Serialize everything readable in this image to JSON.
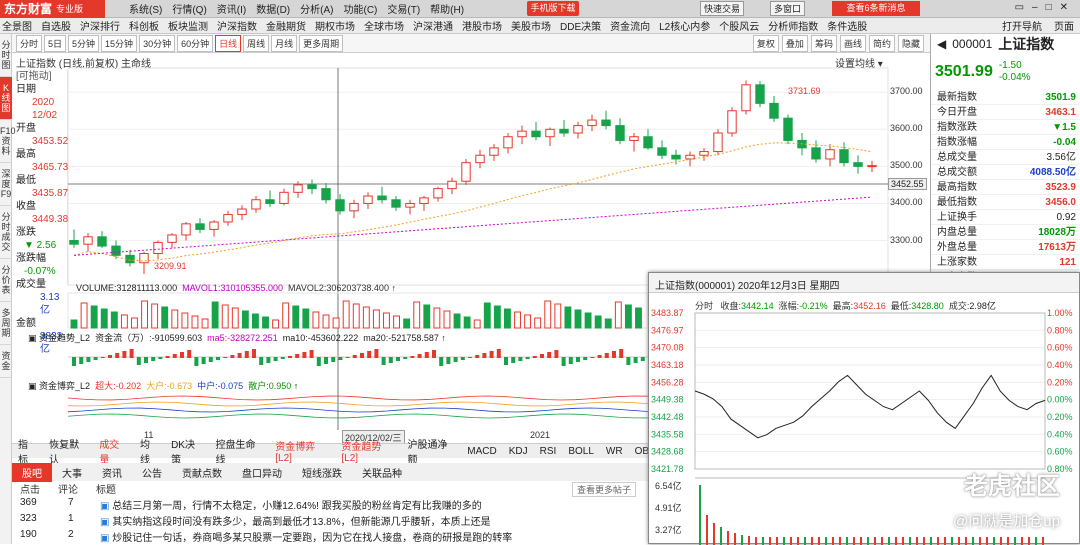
{
  "app": {
    "logo": "东方财富",
    "edition": "专业版"
  },
  "menu": [
    "系统(S)",
    "行情(Q)",
    "资讯(I)",
    "数据(D)",
    "分析(A)",
    "功能(C)",
    "交易(T)",
    "帮助(H)"
  ],
  "top_buttons": {
    "download": "手机版下载",
    "trade": "快速交易",
    "multi": "多窗口",
    "notice": "查看6条新消息"
  },
  "nav": {
    "items": [
      "全景图",
      "自选股",
      "沪深排行",
      "科创板",
      "板块监测",
      "沪深指数",
      "金融期货",
      "期权市场",
      "全球市场",
      "沪深港通",
      "港股市场",
      "美股市场",
      "DDE决策",
      "资金流向",
      "L2核心内参",
      "个股风云",
      "分析师指数",
      "条件选股"
    ],
    "right": [
      "打开导航",
      "页面"
    ]
  },
  "left_nav": [
    "分时图",
    "K线图",
    "F10资料",
    "深度F9",
    "分时成交",
    "分价表",
    "多周期",
    "资金"
  ],
  "period": {
    "items": [
      "分时",
      "5日",
      "5分钟",
      "15分钟",
      "30分钟",
      "60分钟",
      "日线",
      "周线",
      "月线",
      "更多周期"
    ],
    "active": "日线",
    "right": [
      "复权",
      "叠加",
      "筹码",
      "画线",
      "简约",
      "隐藏"
    ]
  },
  "chart": {
    "title": "上证指数 (日线,前复权) 主命线",
    "settings": "设置均线",
    "info": [
      {
        "k": "日期",
        "v": "2020"
      },
      {
        "k": "",
        "v": "12/02"
      },
      {
        "k": "开盘",
        "v": "3453.52"
      },
      {
        "k": "最高",
        "v": "3465.73"
      },
      {
        "k": "最低",
        "v": "3435.87"
      },
      {
        "k": "收盘",
        "v": "3449.38"
      },
      {
        "k": "涨跌",
        "v": "▼ 2.56"
      },
      {
        "k": "涨跌幅",
        "v": "-0.07%"
      },
      {
        "k": "成交量",
        "v": "3.13亿"
      },
      {
        "k": "金额",
        "v": "3833亿"
      }
    ],
    "info_tag": "[可拖动]",
    "price_ticks": [
      "3700.00",
      "3600.00",
      "3500.00",
      "3400.00",
      "3300.00"
    ],
    "current_price": "3452.55",
    "high_label": "3731.69",
    "low_label": "3209.91",
    "dates": [
      "11",
      "2020/12/02/三",
      "2021"
    ],
    "chart_data": {
      "type": "candlestick",
      "ylim": [
        3180,
        3760
      ],
      "ohlc": [
        [
          3300,
          3330,
          3280,
          3290
        ],
        [
          3290,
          3320,
          3270,
          3310
        ],
        [
          3310,
          3325,
          3280,
          3285
        ],
        [
          3285,
          3300,
          3250,
          3260
        ],
        [
          3260,
          3275,
          3230,
          3240
        ],
        [
          3240,
          3270,
          3210,
          3265
        ],
        [
          3265,
          3300,
          3250,
          3295
        ],
        [
          3295,
          3320,
          3280,
          3315
        ],
        [
          3315,
          3350,
          3300,
          3345
        ],
        [
          3345,
          3360,
          3320,
          3330
        ],
        [
          3330,
          3355,
          3310,
          3350
        ],
        [
          3350,
          3380,
          3340,
          3370
        ],
        [
          3370,
          3395,
          3355,
          3385
        ],
        [
          3385,
          3420,
          3375,
          3410
        ],
        [
          3410,
          3435,
          3390,
          3400
        ],
        [
          3400,
          3440,
          3395,
          3430
        ],
        [
          3430,
          3460,
          3415,
          3450
        ],
        [
          3450,
          3465,
          3425,
          3440
        ],
        [
          3440,
          3455,
          3400,
          3410
        ],
        [
          3410,
          3425,
          3370,
          3380
        ],
        [
          3380,
          3410,
          3360,
          3400
        ],
        [
          3400,
          3430,
          3385,
          3420
        ],
        [
          3420,
          3445,
          3400,
          3410
        ],
        [
          3410,
          3420,
          3380,
          3390
        ],
        [
          3390,
          3410,
          3370,
          3400
        ],
        [
          3400,
          3420,
          3380,
          3415
        ],
        [
          3415,
          3445,
          3405,
          3440
        ],
        [
          3440,
          3470,
          3425,
          3460
        ],
        [
          3460,
          3520,
          3450,
          3510
        ],
        [
          3510,
          3545,
          3495,
          3530
        ],
        [
          3530,
          3560,
          3515,
          3550
        ],
        [
          3550,
          3590,
          3535,
          3580
        ],
        [
          3580,
          3610,
          3560,
          3595
        ],
        [
          3595,
          3620,
          3570,
          3580
        ],
        [
          3580,
          3605,
          3555,
          3600
        ],
        [
          3600,
          3625,
          3580,
          3590
        ],
        [
          3590,
          3620,
          3575,
          3610
        ],
        [
          3610,
          3640,
          3595,
          3625
        ],
        [
          3625,
          3650,
          3600,
          3610
        ],
        [
          3610,
          3630,
          3560,
          3570
        ],
        [
          3570,
          3590,
          3540,
          3580
        ],
        [
          3580,
          3600,
          3545,
          3550
        ],
        [
          3550,
          3570,
          3520,
          3530
        ],
        [
          3530,
          3545,
          3505,
          3520
        ],
        [
          3520,
          3540,
          3500,
          3530
        ],
        [
          3530,
          3550,
          3515,
          3540
        ],
        [
          3540,
          3600,
          3530,
          3590
        ],
        [
          3590,
          3660,
          3580,
          3650
        ],
        [
          3650,
          3732,
          3640,
          3720
        ],
        [
          3720,
          3730,
          3660,
          3670
        ],
        [
          3670,
          3690,
          3620,
          3630
        ],
        [
          3630,
          3640,
          3560,
          3570
        ],
        [
          3570,
          3590,
          3530,
          3550
        ],
        [
          3550,
          3570,
          3510,
          3520
        ],
        [
          3520,
          3560,
          3500,
          3545
        ],
        [
          3545,
          3565,
          3500,
          3510
        ],
        [
          3510,
          3530,
          3480,
          3500
        ],
        [
          3500,
          3515,
          3485,
          3502
        ]
      ]
    }
  },
  "vol": {
    "label": "VOLUME:312811113.000",
    "ma1": "MAVOL1:310105355.000",
    "ma2": "MAVOL2:306203738.400"
  },
  "cash": {
    "label": "资金趋势_L2",
    "flow": "资金流（万）:-910599.603",
    "ma5": "ma5:-328272.251",
    "ma10": "ma10:-453602.222",
    "ma20": "ma20:-521758.587"
  },
  "game": {
    "label": "资金博弈_L2",
    "super": "超大:-0.202",
    "big": "大户:-0.673",
    "mid": "中户:-0.075",
    "small": "散户:0.950"
  },
  "ind_tabs": [
    "指标",
    "恢复默认",
    "成交量",
    "均线",
    "DK决策",
    "控盘生命线",
    "资金博弈[L2]",
    "资金趋势[L2]",
    "沪股通净额",
    "MACD",
    "KDJ",
    "RSI",
    "BOLL",
    "WR",
    "OB"
  ],
  "news_tabs": [
    "股吧",
    "大事",
    "资讯",
    "公告",
    "贡献点数",
    "盘口异动",
    "短线涨跌",
    "关联品种"
  ],
  "news_head": [
    "点击",
    "评论",
    "标题"
  ],
  "news_more": "查看更多帖子",
  "news": [
    {
      "clicks": "369",
      "comments": "7",
      "title": "总结三月第一周，行情不太稳定，小赚12.64%! 跟我买股的粉丝肯定有比我赚的多的"
    },
    {
      "clicks": "323",
      "comments": "1",
      "title": "其实纳指这段时间没有跌多少，最高到最低才13.8%，但新能源几乎腰斩，本质上还是"
    },
    {
      "clicks": "190",
      "comments": "2",
      "title": "炒股记住一句话，券商喝多某只股票一定要跑，因为它在找人接盘，卷商的研报是跑的转率"
    }
  ],
  "quote": {
    "code": "000001",
    "name": "上证指数",
    "price": "3501.99",
    "change": "-1.50",
    "pct": "-0.04%",
    "rows": [
      {
        "k": "最新指数",
        "v": "3501.9",
        "c": "g"
      },
      {
        "k": "今日开盘",
        "v": "3463.1",
        "c": "r"
      },
      {
        "k": "指数涨跌",
        "v": "▼1.5",
        "c": "g"
      },
      {
        "k": "指数涨幅",
        "v": "-0.04",
        "c": "g"
      },
      {
        "k": "总成交量",
        "v": "3.56亿",
        "c": "k"
      },
      {
        "k": "总成交额",
        "v": "4088.50亿",
        "c": "b"
      },
      {
        "k": "最高指数",
        "v": "3523.9",
        "c": "r"
      },
      {
        "k": "最低指数",
        "v": "3456.0",
        "c": "r"
      },
      {
        "k": "上证换手",
        "v": "0.92",
        "c": "k"
      },
      {
        "k": "内盘总量",
        "v": "18028万",
        "c": "g"
      },
      {
        "k": "外盘总量",
        "v": "17613万",
        "c": "r"
      },
      {
        "k": "上涨家数",
        "v": "121",
        "c": "r"
      },
      {
        "k": "平盘家数",
        "v": "",
        "c": "k"
      }
    ]
  },
  "popup": {
    "title": "上证指数(000001) 2020年12月3日 星期四",
    "tab": "分时",
    "vol_lbl": "收盘:",
    "vol": "3442.14",
    "chg_lbl": "涨幅:",
    "chg": "-0.21%",
    "hi_lbl": "最高:",
    "hi": "3452.16",
    "lo_lbl": "最低:",
    "lo": "3428.80",
    "amt_lbl": "成交:",
    "amt": "2.98亿",
    "y_left": [
      "3483.87",
      "3476.97",
      "3470.08",
      "3463.18",
      "3456.28",
      "3449.38",
      "3442.48",
      "3435.58",
      "3428.68",
      "3421.78"
    ],
    "y_right": [
      "1.00%",
      "0.80%",
      "0.60%",
      "0.40%",
      "0.20%",
      "0.00%",
      "0.20%",
      "0.40%",
      "0.60%",
      "0.80%"
    ],
    "vol_ticks": [
      "6.54亿",
      "4.91亿",
      "3.27亿"
    ]
  },
  "watermark": {
    "brand": "老虎社区",
    "author": "@问就是加仓up"
  }
}
